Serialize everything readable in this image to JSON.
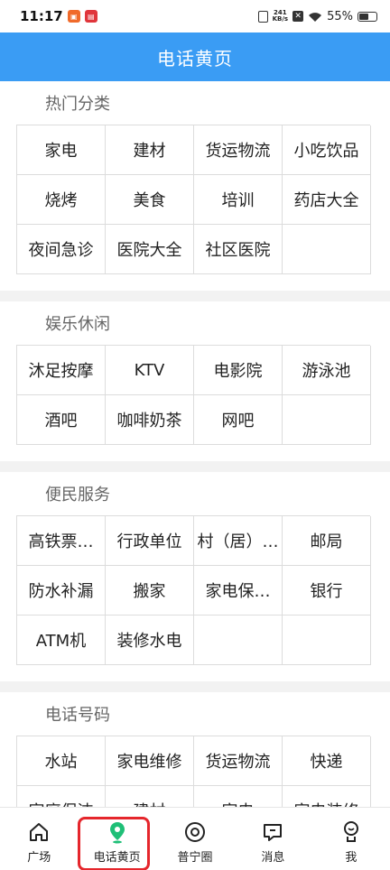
{
  "status_bar": {
    "time": "11:17",
    "net_speed_value": "241",
    "net_speed_unit": "KB/s",
    "battery": "55%"
  },
  "header": {
    "title": "电话黄页"
  },
  "sections": [
    {
      "title": "热门分类",
      "items": [
        "家电",
        "建材",
        "货运物流",
        "小吃饮品",
        "烧烤",
        "美食",
        "培训",
        "药店大全",
        "夜间急诊",
        "医院大全",
        "社区医院",
        ""
      ]
    },
    {
      "title": "娱乐休闲",
      "items": [
        "沐足按摩",
        "KTV",
        "电影院",
        "游泳池",
        "酒吧",
        "咖啡奶茶",
        "网吧",
        ""
      ]
    },
    {
      "title": "便民服务",
      "items": [
        "高铁票…",
        "行政单位",
        "村（居）…",
        "邮局",
        "防水补漏",
        "搬家",
        "家电保…",
        "银行",
        "ATM机",
        "装修水电",
        "",
        ""
      ]
    },
    {
      "title": "电话号码",
      "items": [
        "水站",
        "家电维修",
        "货运物流",
        "快递",
        "家庭保洁",
        "建材",
        "家电",
        "家电装修"
      ]
    }
  ],
  "bottom_nav": [
    {
      "label": "广场",
      "icon": "home-icon"
    },
    {
      "label": "电话黄页",
      "icon": "location-pin-icon",
      "active": true
    },
    {
      "label": "普宁圈",
      "icon": "circle-target-icon"
    },
    {
      "label": "消息",
      "icon": "message-icon"
    },
    {
      "label": "我",
      "icon": "user-icon"
    }
  ],
  "colors": {
    "header_bg": "#3a9cf4",
    "active_icon": "#1fbf77",
    "highlight": "#e5262c"
  }
}
